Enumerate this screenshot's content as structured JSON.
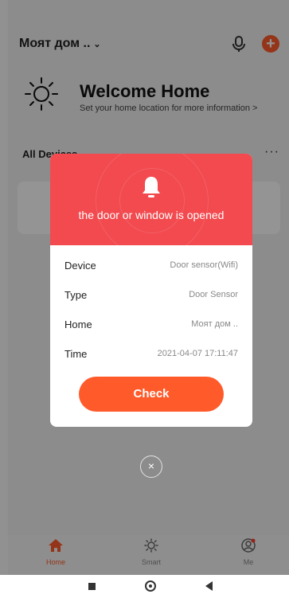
{
  "header": {
    "home_name": "Моят дом ..",
    "chevron": "⌄"
  },
  "welcome": {
    "title": "Welcome Home",
    "subtitle": "Set your home location for more information >"
  },
  "devices": {
    "section_label": "All Devices",
    "more": "···"
  },
  "alert": {
    "title": "the door or window is  opened",
    "rows": [
      {
        "label": "Device",
        "value": "Door sensor(Wifi)"
      },
      {
        "label": "Type",
        "value": "Door Sensor"
      },
      {
        "label": "Home",
        "value": "Моят дом .."
      },
      {
        "label": "Time",
        "value": "2021-04-07 17:11:47"
      }
    ],
    "check_label": "Check",
    "close_symbol": "×"
  },
  "tabs": [
    {
      "label": "Home",
      "icon": "home-icon",
      "active": true
    },
    {
      "label": "Smart",
      "icon": "sun-icon",
      "active": false
    },
    {
      "label": "Me",
      "icon": "user-icon",
      "active": false
    }
  ],
  "colors": {
    "accent": "#ff5a2a",
    "alert_red": "#f24a4f"
  }
}
